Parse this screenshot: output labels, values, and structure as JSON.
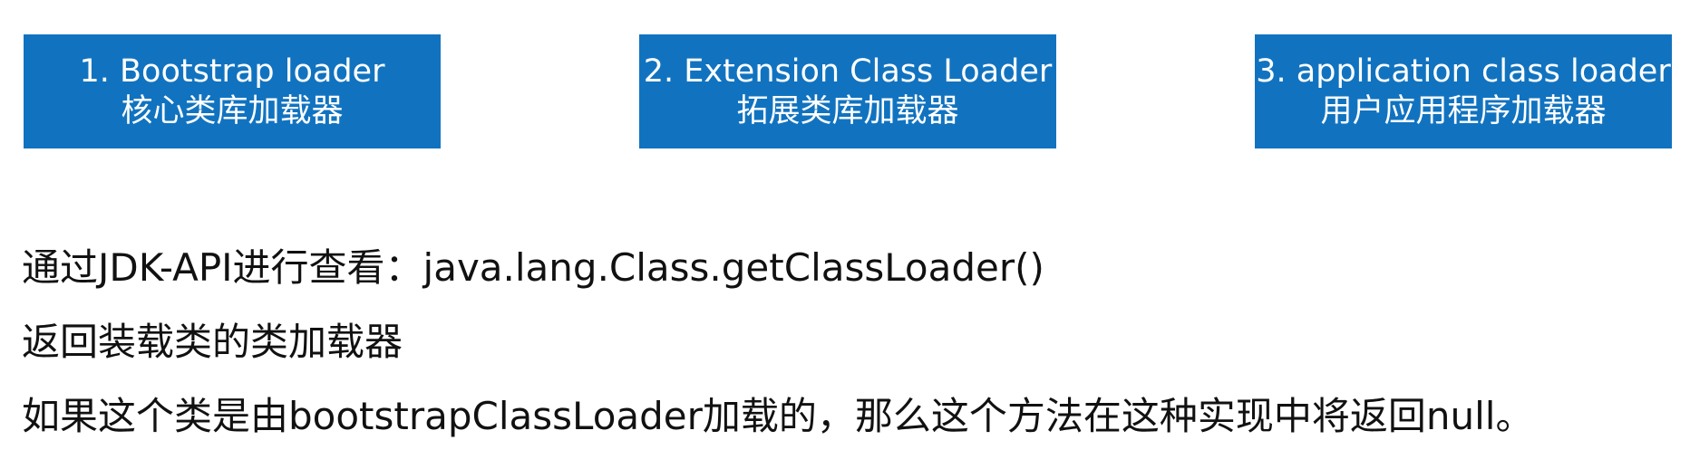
{
  "loaders": [
    {
      "title": "1. Bootstrap loader",
      "subtitle": "核心类库加载器"
    },
    {
      "title": "2. Extension Class Loader",
      "subtitle": "拓展类库加载器"
    },
    {
      "title": "3. application class loader",
      "subtitle": "用户应用程序加载器"
    }
  ],
  "notes": [
    "通过JDK-API进行查看：java.lang.Class.getClassLoader()",
    "返回装载类的类加载器",
    "如果这个类是由bootstrapClassLoader加载的，那么这个方法在这种实现中将返回null。"
  ],
  "colors": {
    "box_background": "#1173c0",
    "box_text": "#ffffff",
    "body_text": "#111111"
  }
}
